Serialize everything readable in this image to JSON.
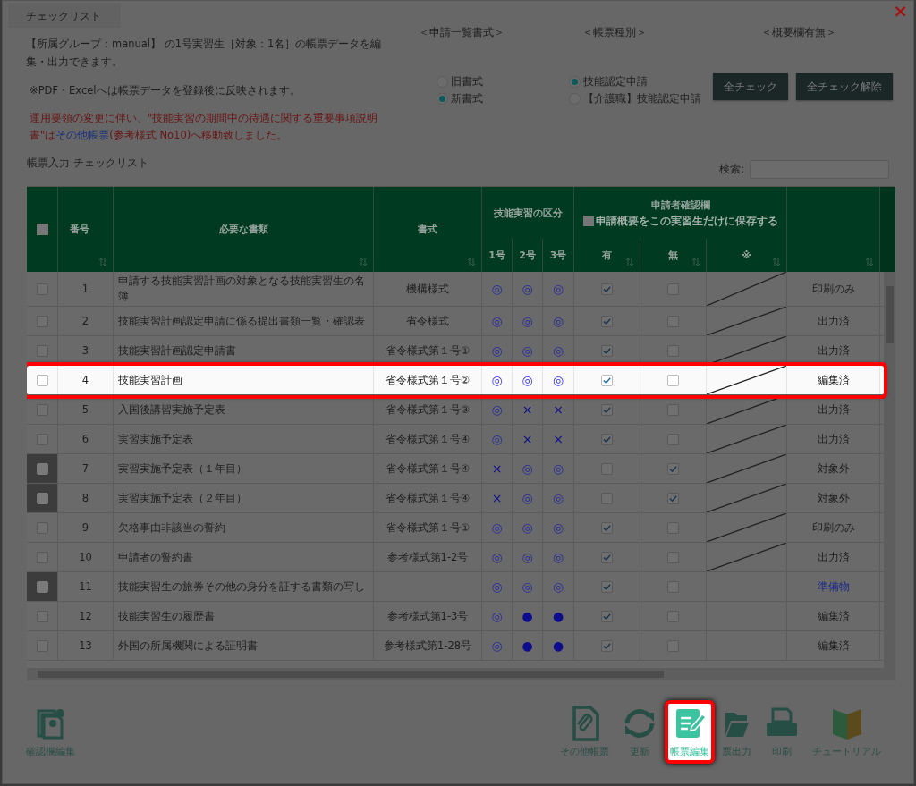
{
  "dialog": {
    "tab": "チェックリスト",
    "close": "×"
  },
  "intro": {
    "lines": [
      "【所属グループ：manual】 の1号実習生［対象：1名］の帳票データを編集・出力できます。",
      "※PDF・Excelへは帳票データを登録後に反映されます。"
    ],
    "notice": {
      "before": "運用要領の変更に伴い、\"技能実習の期間中の待遇に関する重要事項説明書\"は",
      "link": "その他帳票",
      "after": "(参考様式 No10)へ移動致しました。"
    }
  },
  "settings": [
    {
      "heading": "＜申請一覧書式＞",
      "options": [
        {
          "label": "旧書式",
          "selected": false
        },
        {
          "label": "新書式",
          "selected": true
        }
      ]
    },
    {
      "heading": "＜帳票種別＞",
      "options": [
        {
          "label": "技能認定申請",
          "selected": true
        },
        {
          "label": "【介護職】技能認定申請",
          "selected": false
        }
      ]
    },
    {
      "heading": "＜概要欄有無＞",
      "buttons": [
        "全チェック",
        "全チェック解除"
      ]
    }
  ],
  "section_title": "帳票入力 チェックリスト",
  "search": {
    "label": "検索:"
  },
  "table": {
    "columns": {
      "number": "番号",
      "document": "必要な書類",
      "format": "書式",
      "class_group": "技能実習の区分",
      "class_1": "1号",
      "class_2": "2号",
      "class_3": "3号",
      "confirm_group": "申請者確認欄",
      "save_option": "申請概要をこの実習生だけに保存する",
      "yes": "有",
      "no": "無",
      "note": "※"
    },
    "save_option_checked": false,
    "select_all_checked": false,
    "rows": [
      {
        "number": "1",
        "document": "申請する技能実習計画の対象となる技能実習生の名簿",
        "format": "機構様式",
        "class_1": "◎",
        "class_2": "◎",
        "class_3": "◎",
        "yes": true,
        "no": false,
        "slashed": true,
        "status": "印刷のみ",
        "status_link": false,
        "checked": false,
        "disabled": false,
        "highlighted": false
      },
      {
        "number": "2",
        "document": "技能実習計画認定申請に係る提出書類一覧・確認表",
        "format": "省令様式",
        "class_1": "◎",
        "class_2": "◎",
        "class_3": "◎",
        "yes": true,
        "no": false,
        "slashed": true,
        "status": "出力済",
        "status_link": false,
        "checked": false,
        "disabled": false,
        "highlighted": false
      },
      {
        "number": "3",
        "document": "技能実習計画認定申請書",
        "format": "省令様式第１号①",
        "class_1": "◎",
        "class_2": "◎",
        "class_3": "◎",
        "yes": true,
        "no": false,
        "slashed": true,
        "status": "出力済",
        "status_link": false,
        "checked": false,
        "disabled": false,
        "highlighted": false
      },
      {
        "number": "4",
        "document": "技能実習計画",
        "format": "省令様式第１号②",
        "class_1": "◎",
        "class_2": "◎",
        "class_3": "◎",
        "yes": true,
        "no": false,
        "slashed": true,
        "status": "編集済",
        "status_link": false,
        "checked": false,
        "disabled": false,
        "highlighted": true
      },
      {
        "number": "5",
        "document": "入国後講習実施予定表",
        "format": "省令様式第１号③",
        "class_1": "◎",
        "class_2": "×",
        "class_3": "×",
        "yes": true,
        "no": false,
        "slashed": true,
        "status": "出力済",
        "status_link": false,
        "checked": false,
        "disabled": false,
        "highlighted": false
      },
      {
        "number": "6",
        "document": "実習実施予定表",
        "format": "省令様式第１号④",
        "class_1": "◎",
        "class_2": "×",
        "class_3": "×",
        "yes": true,
        "no": false,
        "slashed": true,
        "status": "出力済",
        "status_link": false,
        "checked": false,
        "disabled": false,
        "highlighted": false
      },
      {
        "number": "7",
        "document": "実習実施予定表（１年目）",
        "format": "省令様式第１号④",
        "class_1": "×",
        "class_2": "◎",
        "class_3": "◎",
        "yes": false,
        "no": true,
        "slashed": true,
        "status": "対象外",
        "status_link": false,
        "checked": false,
        "disabled": true,
        "highlighted": false
      },
      {
        "number": "8",
        "document": "実習実施予定表（２年目）",
        "format": "省令様式第１号④",
        "class_1": "×",
        "class_2": "◎",
        "class_3": "◎",
        "yes": false,
        "no": true,
        "slashed": true,
        "status": "対象外",
        "status_link": false,
        "checked": false,
        "disabled": true,
        "highlighted": false
      },
      {
        "number": "9",
        "document": "欠格事由非該当の誓約",
        "format": "省令様式第１号①",
        "class_1": "◎",
        "class_2": "◎",
        "class_3": "◎",
        "yes": true,
        "no": false,
        "slashed": true,
        "status": "印刷のみ",
        "status_link": false,
        "checked": false,
        "disabled": false,
        "highlighted": false
      },
      {
        "number": "10",
        "document": "申請者の誓約書",
        "format": "参考様式第1-2号",
        "class_1": "◎",
        "class_2": "◎",
        "class_3": "◎",
        "yes": true,
        "no": false,
        "slashed": true,
        "status": "出力済",
        "status_link": false,
        "checked": false,
        "disabled": false,
        "highlighted": false
      },
      {
        "number": "11",
        "document": "技能実習生の旅券その他の身分を証する書類の写し",
        "class_1": "◎",
        "class_2": "◎",
        "class_3": "◎",
        "yes": true,
        "no": false,
        "slashed": false,
        "status": "準備物",
        "status_link": true,
        "checked": false,
        "disabled": true,
        "highlighted": false
      },
      {
        "number": "12",
        "document": "技能実習生の履歴書",
        "format": "参考様式第1-3号",
        "class_1": "◎",
        "class_2": "●",
        "class_3": "●",
        "yes": true,
        "no": false,
        "slashed": false,
        "status": "編集済",
        "status_link": false,
        "checked": false,
        "disabled": false,
        "highlighted": false
      },
      {
        "number": "13",
        "document": "外国の所属機関による証明書",
        "format": "参考様式第1-28号",
        "class_1": "◎",
        "class_2": "●",
        "class_3": "●",
        "yes": true,
        "no": false,
        "slashed": false,
        "status": "編集済",
        "status_link": false,
        "checked": false,
        "disabled": false,
        "highlighted": false
      }
    ]
  },
  "toolbar": {
    "left": [
      {
        "kind": "gear",
        "label": "確認欄編集",
        "highlighted": false
      }
    ],
    "right": [
      {
        "kind": "clip",
        "label": "その他帳票",
        "highlighted": false
      },
      {
        "kind": "refresh",
        "label": "更新",
        "highlighted": false
      },
      {
        "kind": "edit",
        "label": "帳票編集",
        "highlighted": true
      },
      {
        "kind": "folder",
        "label": "票出力",
        "highlighted": false
      },
      {
        "kind": "printer",
        "label": "印刷",
        "highlighted": false
      },
      {
        "kind": "beginner",
        "label": "チュートリアル",
        "highlighted": false
      }
    ]
  }
}
